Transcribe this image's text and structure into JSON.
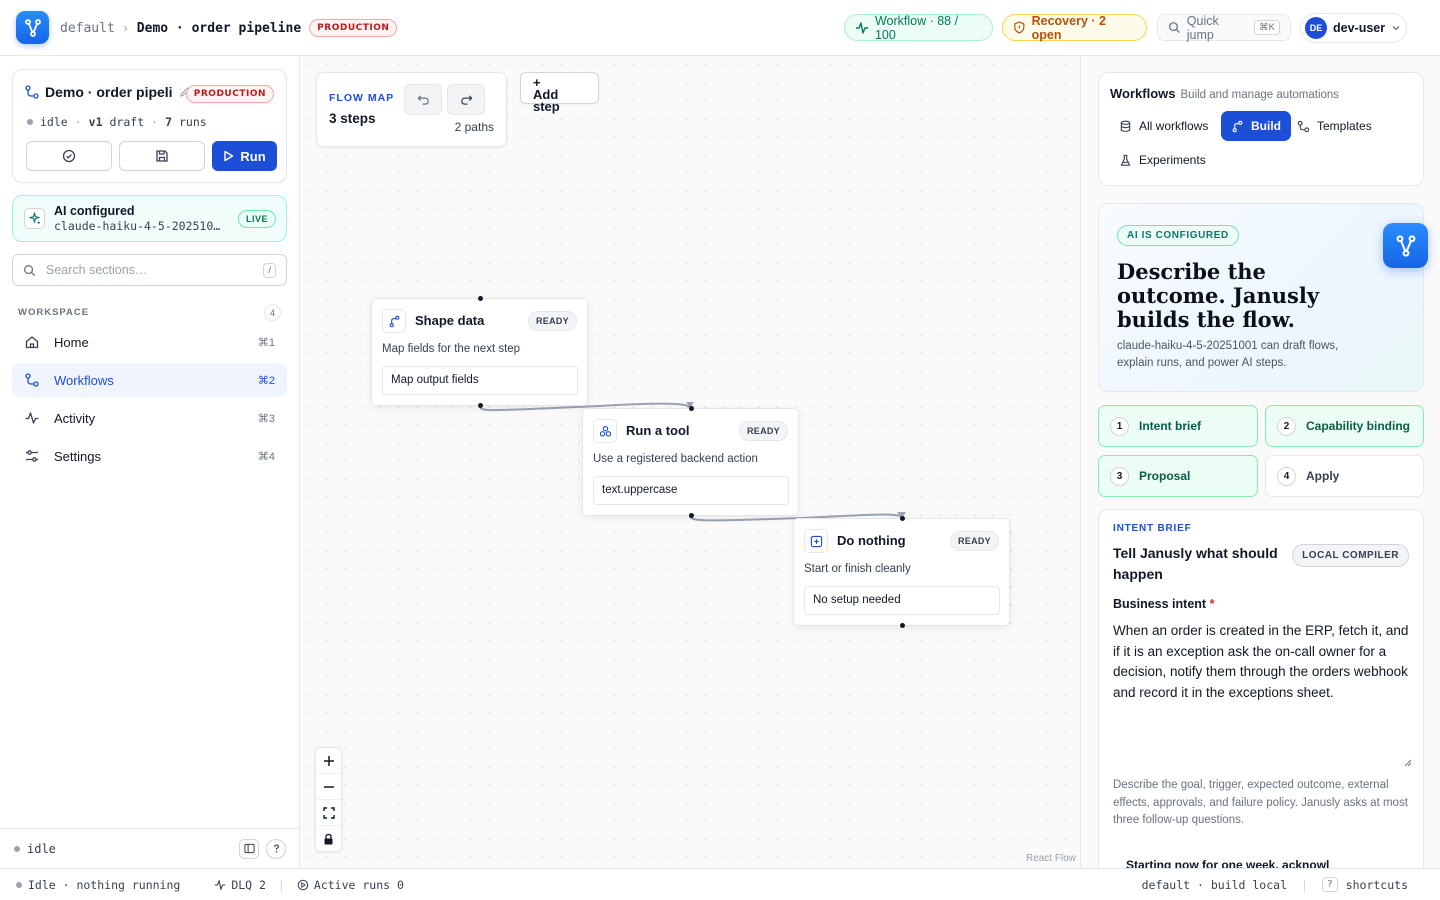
{
  "topbar": {
    "crumb_workspace": "default",
    "crumb_sep": "›",
    "crumb_pipeline": "Demo · order pipeline",
    "env_badge": "PRODUCTION",
    "workflow_pill": "Workflow · 88 / 100",
    "recovery_pill": "Recovery · 2 open",
    "quickjump_label": "Quick jump",
    "quickjump_kbd": "⌘K",
    "user_initials": "DE",
    "user_name": "dev-user"
  },
  "sidebar": {
    "workflow_name": "Demo · order pipeli",
    "env_badge": "PRODUCTION",
    "state": "idle",
    "version_num": "v1",
    "version_state": "draft",
    "runs_num": "7",
    "runs_label": "runs",
    "run_label": "Run",
    "ai_title": "AI configured",
    "ai_model": "claude-haiku-4-5-202510…",
    "ai_live": "LIVE",
    "search_placeholder": "Search sections…",
    "search_kbd": "/",
    "workspace_label": "WORKSPACE",
    "workspace_count": "4",
    "nav": [
      {
        "label": "Home",
        "shortcut": "⌘1"
      },
      {
        "label": "Workflows",
        "shortcut": "⌘2"
      },
      {
        "label": "Activity",
        "shortcut": "⌘3"
      },
      {
        "label": "Settings",
        "shortcut": "⌘4"
      }
    ],
    "footer_state": "idle"
  },
  "canvas": {
    "flowmap_label": "FLOW MAP",
    "flowmap_steps": "3 steps",
    "flowmap_paths": "2 paths",
    "add_step_plus": "+",
    "add_step_label": "Add step",
    "nodes": [
      {
        "title": "Shape data",
        "status": "READY",
        "description": "Map fields for the next step",
        "field": "Map output fields"
      },
      {
        "title": "Run a tool",
        "status": "READY",
        "description": "Use a registered backend action",
        "field": "text.uppercase"
      },
      {
        "title": "Do nothing",
        "status": "READY",
        "description": "Start or finish cleanly",
        "field": "No setup needed"
      }
    ],
    "attribution": "React Flow"
  },
  "rightpanel": {
    "title": "Workflows",
    "subtitle": "Build and manage automations",
    "tabs": [
      "All workflows",
      "Build",
      "Templates",
      "Experiments"
    ],
    "hero_badge": "AI IS CONFIGURED",
    "hero_title": "Describe the outcome. Janusly builds the flow.",
    "hero_desc": "claude-haiku-4-5-20251001 can draft flows, explain runs, and power AI steps.",
    "steps": [
      {
        "num": "1",
        "label": "Intent brief"
      },
      {
        "num": "2",
        "label": "Capability binding"
      },
      {
        "num": "3",
        "label": "Proposal"
      },
      {
        "num": "4",
        "label": "Apply"
      }
    ],
    "brief_label": "INTENT BRIEF",
    "brief_title": "Tell Janusly what should happen",
    "brief_badge": "LOCAL COMPILER",
    "intent_label": "Business intent",
    "intent_required": "*",
    "intent_text": "When an order is created in the ERP, fetch it, and if it is an exception ask the on-call owner for a decision, notify them through the orders webhook and record it in the exceptions sheet.",
    "intent_help": "Describe the goal, trigger, expected outcome, external effects, approvals, and failure policy. Janusly asks at most three follow-up questions.",
    "more_text": "Starting now for one week, acknowl"
  },
  "statusbar": {
    "state": "Idle · nothing running",
    "dlq": "DLQ 2",
    "active_runs": "Active runs 0",
    "env": "default · build local",
    "help_kbd": "?",
    "shortcuts": "shortcuts"
  },
  "colors": {
    "accent": "#1d4ed8",
    "production": "#b91c1c",
    "success": "#047857",
    "warning": "#b45309"
  }
}
